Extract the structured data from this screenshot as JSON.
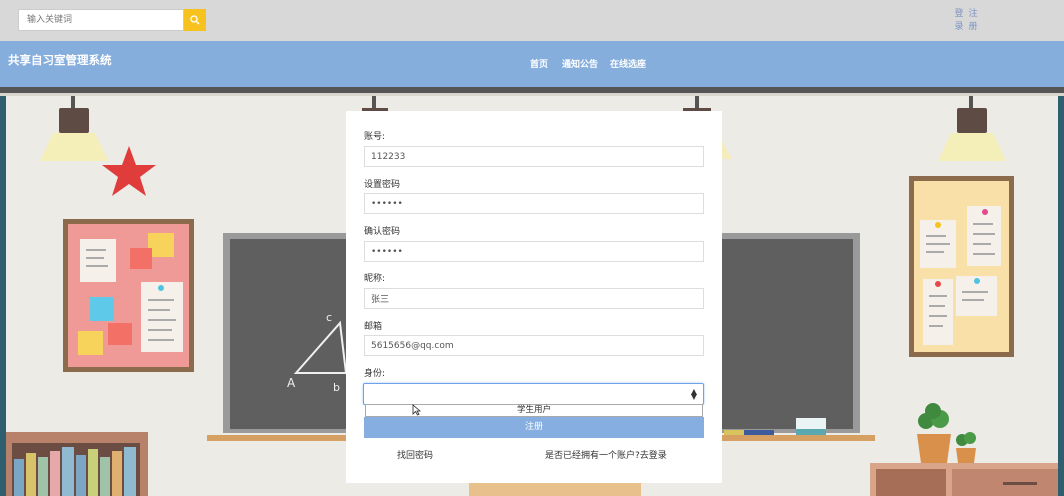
{
  "header": {
    "search_placeholder": "输入关键词",
    "login": "登录",
    "register": "注册"
  },
  "navbar": {
    "brand": "共享自习室管理系统",
    "items": [
      {
        "label": "首页"
      },
      {
        "label": "通知公告"
      },
      {
        "label": "在线选座"
      }
    ]
  },
  "form": {
    "account": {
      "label": "账号:",
      "value": "112233"
    },
    "password": {
      "label": "设置密码",
      "value": "••••••"
    },
    "confirm": {
      "label": "确认密码",
      "value": "••••••"
    },
    "nickname": {
      "label": "昵称:",
      "value": "张三"
    },
    "email": {
      "label": "邮箱",
      "value": "5615656@qq.com"
    },
    "identity": {
      "label": "身份:",
      "value": "",
      "options": [
        "学生用户"
      ]
    },
    "submit_label": "注册",
    "find_password": "找回密码",
    "have_account": "是否已经拥有一个账户?去登录"
  },
  "colors": {
    "navbar": "#85aedd",
    "search_button": "#f7c21e",
    "submit_button": "#86aee0"
  }
}
